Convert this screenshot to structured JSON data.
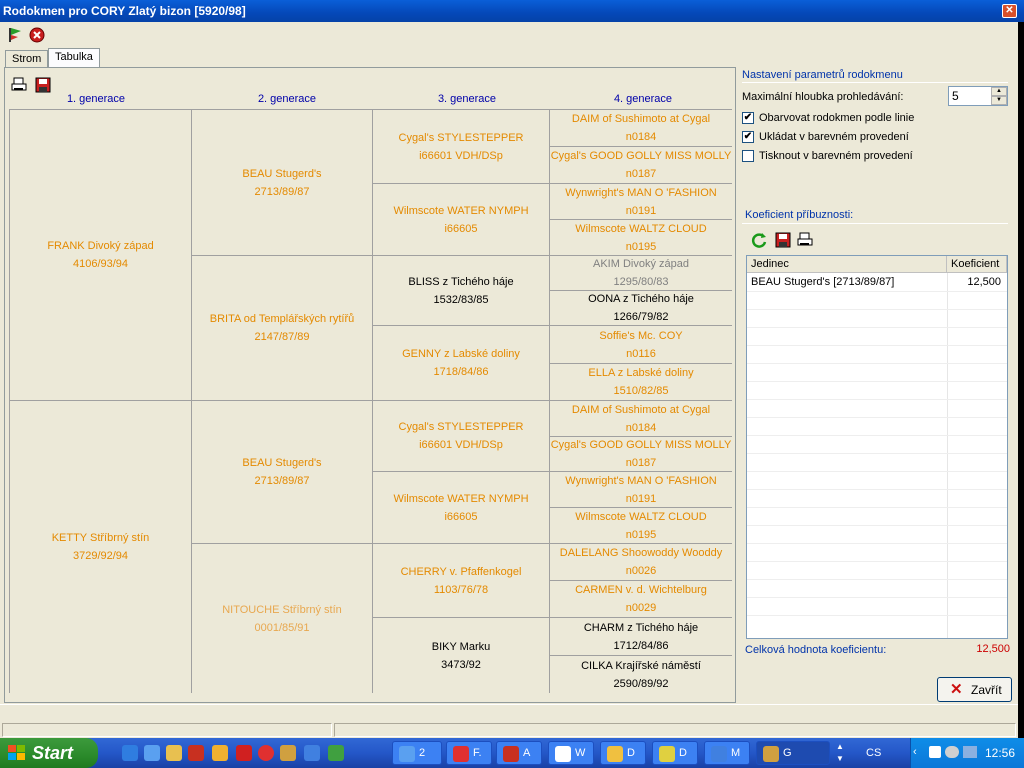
{
  "window": {
    "title": "Rodokmen pro CORY Zlatý bizon [5920/98]"
  },
  "tabs": [
    {
      "label": "Strom"
    },
    {
      "label": "Tabulka"
    }
  ],
  "generations": [
    "1. generace",
    "2. generace",
    "3. generace",
    "4. generace"
  ],
  "pedigree": {
    "gen1": [
      {
        "name": "FRANK Divoký západ",
        "id": "4106/93/94"
      },
      {
        "name": "KETTY Stříbrný stín",
        "id": "3729/92/94"
      }
    ],
    "gen2": [
      {
        "name": "BEAU Stugerd's",
        "id": "2713/89/87"
      },
      {
        "name": "BRITA od Templářských rytířů",
        "id": "2147/87/89"
      },
      {
        "name": "BEAU Stugerd's",
        "id": "2713/89/87"
      },
      {
        "name": "NITOUCHE Stříbrný stín",
        "id": "0001/85/91"
      }
    ],
    "gen3": [
      {
        "name": "Cygal's STYLESTEPPER",
        "id": "i66601 VDH/DSp"
      },
      {
        "name": "Wilmscote WATER NYMPH",
        "id": "i66605"
      },
      {
        "name": "BLISS z Tichého háje",
        "id": "1532/83/85"
      },
      {
        "name": "GENNY z Labské doliny",
        "id": "1718/84/86"
      },
      {
        "name": "Cygal's STYLESTEPPER",
        "id": "i66601 VDH/DSp"
      },
      {
        "name": "Wilmscote WATER NYMPH",
        "id": "i66605"
      },
      {
        "name": "CHERRY v. Pfaffenkogel",
        "id": "1103/76/78"
      },
      {
        "name": "BIKY Marku",
        "id": "3473/92"
      }
    ],
    "gen4": [
      {
        "name": "DAIM of Sushimoto at Cygal",
        "id": "n0184"
      },
      {
        "name": "Cygal's GOOD GOLLY MISS MOLLY",
        "id": "n0187"
      },
      {
        "name": "Wynwright's MAN O 'FASHION",
        "id": "n0191"
      },
      {
        "name": "Wilmscote WALTZ CLOUD",
        "id": "n0195"
      },
      {
        "name": "AKIM Divoký západ",
        "id": "1295/80/83"
      },
      {
        "name": "OONA z Tichého háje",
        "id": "1266/79/82"
      },
      {
        "name": "Soffie's Mc. COY",
        "id": "n0116"
      },
      {
        "name": "ELLA z Labské doliny",
        "id": "1510/82/85"
      },
      {
        "name": "DAIM of Sushimoto at Cygal",
        "id": "n0184"
      },
      {
        "name": "Cygal's GOOD GOLLY MISS MOLLY",
        "id": "n0187"
      },
      {
        "name": "Wynwright's MAN O 'FASHION",
        "id": "n0191"
      },
      {
        "name": "Wilmscote WALTZ CLOUD",
        "id": "n0195"
      },
      {
        "name": "DALELANG Shoowoddy Wooddy",
        "id": "n0026"
      },
      {
        "name": "CARMEN v. d. Wichtelburg",
        "id": "n0029"
      },
      {
        "name": "CHARM z Tichého háje",
        "id": "1712/84/86"
      },
      {
        "name": "CILKA Krajířské náměstí",
        "id": "2590/89/92"
      }
    ]
  },
  "settings": {
    "heading": "Nastavení parametrů rodokmenu",
    "depth_label": "Maximální hloubka prohledávání:",
    "depth_value": "5",
    "options": [
      {
        "label": "Obarvovat rodokmen podle linie",
        "checked": "✔"
      },
      {
        "label": "Ukládat v barevném provedení",
        "checked": "✔"
      },
      {
        "label": "Tisknout v barevném provedení",
        "checked": ""
      }
    ]
  },
  "coefficient": {
    "heading": "Koeficient příbuznosti:",
    "columns": [
      "Jedinec",
      "Koeficient"
    ],
    "rows": [
      {
        "name": "BEAU Stugerd's [2713/89/87]",
        "value": "12,500"
      }
    ],
    "total_label": "Celková hodnota koeficientu:",
    "total_value": "12,500"
  },
  "buttons": {
    "close": "Zavřít"
  },
  "taskbar": {
    "start": "Start",
    "tasks": [
      "2",
      "F.",
      "A",
      "W",
      "D",
      "D",
      "M",
      "G"
    ],
    "lang": "CS",
    "clock": "12:56"
  }
}
